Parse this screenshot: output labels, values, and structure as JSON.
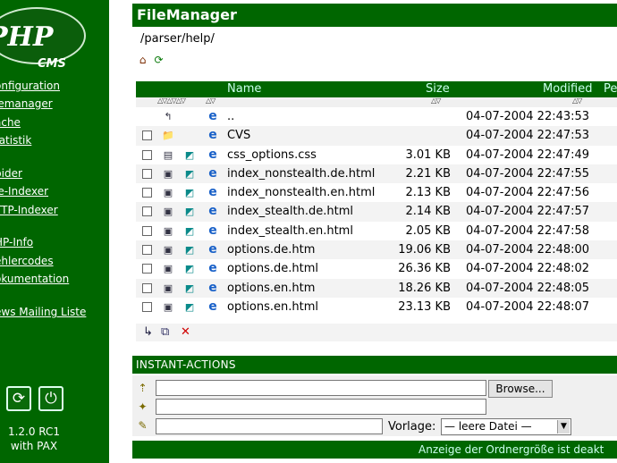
{
  "sidebar": {
    "logo": {
      "main": "PHP",
      "sub": "CMS"
    },
    "nav_items": [
      {
        "label": "onfiguration"
      },
      {
        "label": "lemanager"
      },
      {
        "label": "ache"
      },
      {
        "label": "tatistik"
      },
      {
        "label": "pider"
      },
      {
        "label": "le-Indexer"
      },
      {
        "label": "TTP-Indexer"
      },
      {
        "label": "HP-Info"
      },
      {
        "label": "ehlercodes"
      },
      {
        "label": "okumentation"
      },
      {
        "label": "ews Mailing Liste"
      }
    ],
    "buttons": [
      {
        "icon": "refresh-icon",
        "glyph": "⟳"
      },
      {
        "icon": "power-icon",
        "glyph": "⏻"
      }
    ],
    "version_line1": "1.2.0 RC1",
    "version_line2": "with PAX",
    "bg_color": "#006600"
  },
  "filemanager": {
    "title": "FileManager",
    "path": "/parser/help/",
    "columns": {
      "name": "Name",
      "size": "Size",
      "modified": "Modified",
      "perms": "Pe"
    },
    "files": [
      {
        "name": "..",
        "size": "",
        "modified": "04-07-2004 22:43:53",
        "type": "parent",
        "checkbox": false,
        "ic1": "↰",
        "ic2": "",
        "ic3": "e"
      },
      {
        "name": "CVS",
        "size": "",
        "modified": "04-07-2004 22:47:53",
        "type": "folder",
        "checkbox": true,
        "ic1": "📁",
        "ic2": "",
        "ic3": "e"
      },
      {
        "name": "css_options.css",
        "size": "3.01 KB",
        "modified": "04-07-2004 22:47:49",
        "type": "file",
        "checkbox": true,
        "ic1": "▤",
        "ic2": "◩",
        "ic3": "e"
      },
      {
        "name": "index_nonstealth.de.html",
        "size": "2.21 KB",
        "modified": "04-07-2004 22:47:55",
        "type": "file",
        "checkbox": true,
        "ic1": "▣",
        "ic2": "◩",
        "ic3": "e"
      },
      {
        "name": "index_nonstealth.en.html",
        "size": "2.13 KB",
        "modified": "04-07-2004 22:47:56",
        "type": "file",
        "checkbox": true,
        "ic1": "▣",
        "ic2": "◩",
        "ic3": "e"
      },
      {
        "name": "index_stealth.de.html",
        "size": "2.14 KB",
        "modified": "04-07-2004 22:47:57",
        "type": "file",
        "checkbox": true,
        "ic1": "▣",
        "ic2": "◩",
        "ic3": "e"
      },
      {
        "name": "index_stealth.en.html",
        "size": "2.05 KB",
        "modified": "04-07-2004 22:47:58",
        "type": "file",
        "checkbox": true,
        "ic1": "▣",
        "ic2": "◩",
        "ic3": "e"
      },
      {
        "name": "options.de.htm",
        "size": "19.06 KB",
        "modified": "04-07-2004 22:48:00",
        "type": "file",
        "checkbox": true,
        "ic1": "▣",
        "ic2": "◩",
        "ic3": "e"
      },
      {
        "name": "options.de.html",
        "size": "26.36 KB",
        "modified": "04-07-2004 22:48:02",
        "type": "file",
        "checkbox": true,
        "ic1": "▣",
        "ic2": "◩",
        "ic3": "e"
      },
      {
        "name": "options.en.htm",
        "size": "18.26 KB",
        "modified": "04-07-2004 22:48:05",
        "type": "file",
        "checkbox": true,
        "ic1": "▣",
        "ic2": "◩",
        "ic3": "e"
      },
      {
        "name": "options.en.html",
        "size": "23.13 KB",
        "modified": "04-07-2004 22:48:07",
        "type": "file",
        "checkbox": true,
        "ic1": "▣",
        "ic2": "◩",
        "ic3": "e"
      }
    ],
    "footer_icons": [
      {
        "name": "move-icon",
        "glyph": "↳"
      },
      {
        "name": "copy-icon",
        "glyph": "⧉"
      },
      {
        "name": "delete-icon",
        "glyph": "✕"
      }
    ]
  },
  "instant_actions": {
    "title": "INSTANT-ACTIONS",
    "browse_label": "Browse...",
    "vorlage_label": "Vorlage:",
    "vorlage_value": "— leere Datei —"
  },
  "status_bar": {
    "text": "Anzeige der Ordnergröße ist deakt"
  }
}
